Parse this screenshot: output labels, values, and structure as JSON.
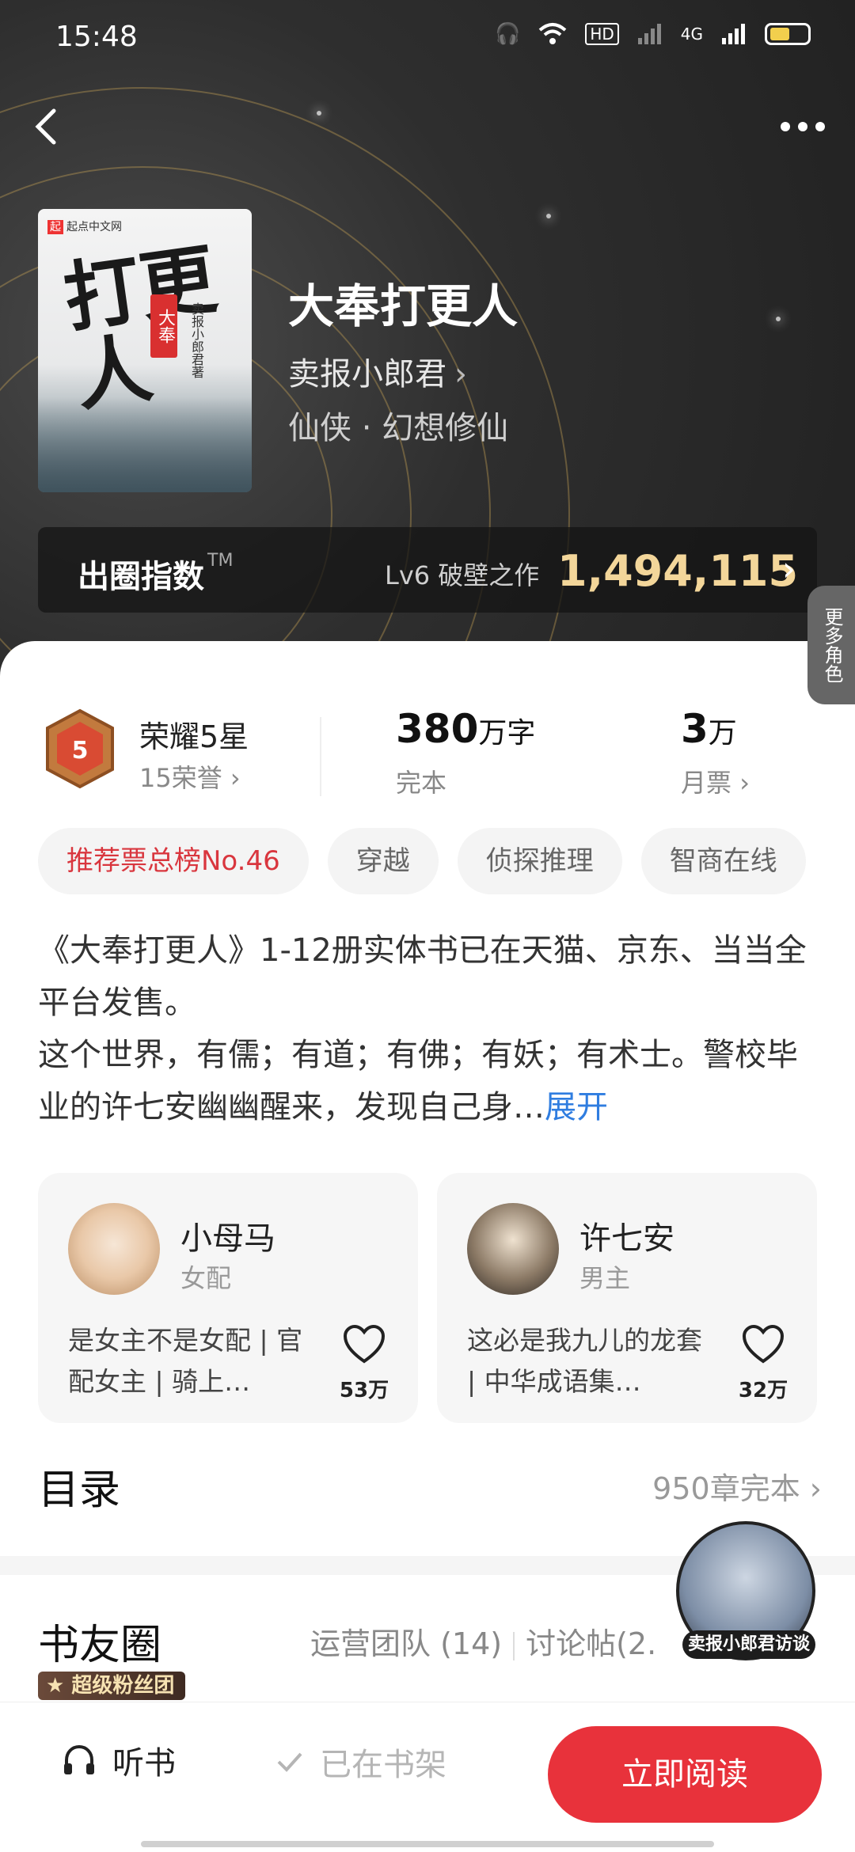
{
  "status_bar": {
    "time": "15:48",
    "network": "4G"
  },
  "cover": {
    "publisher": "起点中文网",
    "title_art": "打更人",
    "seal": "大奉",
    "author_vertical": "卖报小郎君著"
  },
  "book": {
    "title": "大奉打更人",
    "author": "卖报小郎君",
    "genre": "仙侠 · 幻想修仙"
  },
  "index_bar": {
    "label": "出圈指数",
    "tm": "TM",
    "level": "Lv6 破壁之作",
    "value": "1,494,115"
  },
  "stats": {
    "honor_title": "荣耀5星",
    "honor_sub": "15荣誉",
    "medal_number": "5",
    "words_num": "380",
    "words_unit": "万字",
    "words_sub": "完本",
    "tickets_num": "3",
    "tickets_unit": "万",
    "tickets_sub": "月票"
  },
  "tags": [
    "推荐票总榜No.46",
    "穿越",
    "侦探推理",
    "智商在线"
  ],
  "description": {
    "line1": "《大奉打更人》1-12册实体书已在天猫、京东、当当全平台发售。",
    "line2": "这个世界，有儒；有道；有佛；有妖；有术士。警校毕业的许七安幽幽醒来，发现自己身…",
    "expand": "展开"
  },
  "characters": [
    {
      "name": "小母马",
      "role": "女配",
      "desc": "是女主不是女配 | 官配女主 | 骑上…",
      "likes": "53万"
    },
    {
      "name": "许七安",
      "role": "男主",
      "desc": "这必是我九儿的龙套 | 中华成语集…",
      "likes": "32万"
    }
  ],
  "more_roles": "更多角色",
  "toc": {
    "title": "目录",
    "status": "950章完本"
  },
  "circle": {
    "title": "书友圈",
    "badge": "超级粉丝团",
    "team": "运营团队 (14)",
    "posts": "讨论帖(2."
  },
  "floating": {
    "label": "卖报小郎君访谈"
  },
  "bottom_bar": {
    "listen": "听书",
    "shelf": "已在书架",
    "read": "立即阅读"
  },
  "colors": {
    "accent_red": "#e8323b",
    "gold": "#f3d69a",
    "link_blue": "#2f7de0"
  }
}
